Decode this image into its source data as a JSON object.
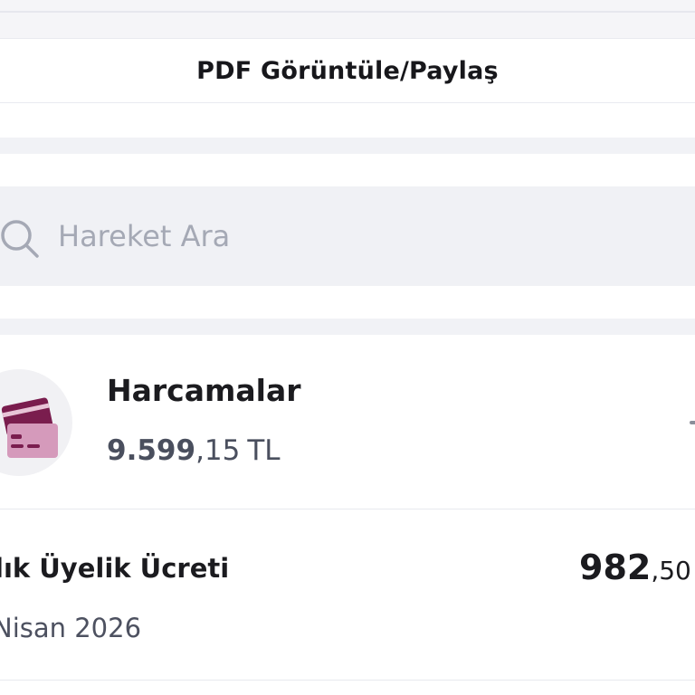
{
  "actions": {
    "pdf_label": "PDF Görüntüle/Paylaş"
  },
  "search": {
    "placeholder": "Hareket Ara",
    "value": "",
    "icon": "search-icon"
  },
  "summary": {
    "title": "Harcamalar",
    "amount_int": "9.599",
    "amount_dec": ",15",
    "currency": "TL",
    "icon": "credit-card-icon"
  },
  "transaction": {
    "title": "lık Üyelik Ücreti",
    "date": "Nisan 2026",
    "amount_int": "982",
    "amount_dec": ",50"
  },
  "colors": {
    "accent": "#7a1d4e",
    "accent_light": "#d59abb",
    "search_bg": "#f0f1f5",
    "section_bg": "#f1f2f6"
  }
}
